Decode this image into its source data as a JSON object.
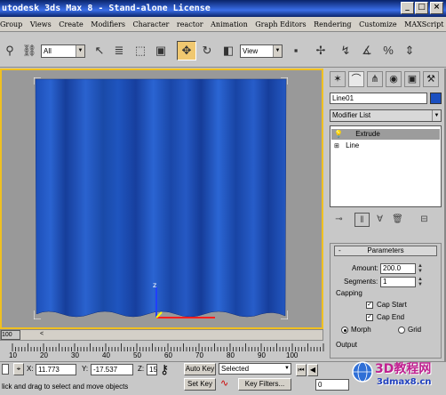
{
  "window": {
    "title": "utodesk 3ds Max 8  -  Stand-alone License"
  },
  "menu": [
    "Group",
    "Views",
    "Create",
    "Modifiers",
    "Character",
    "reactor",
    "Animation",
    "Graph Editors",
    "Rendering",
    "Customize",
    "MAXScript"
  ],
  "toolbar": {
    "selection_filter": "All",
    "ref_coord": "View"
  },
  "panel": {
    "object_name": "Line01",
    "object_color": "#1a4fc0",
    "modifier_list": "Modifier List",
    "stack": [
      {
        "label": "Extrude"
      },
      {
        "label": "Line"
      }
    ],
    "params": {
      "title": "Parameters",
      "amount_label": "Amount:",
      "amount": "200.0",
      "segments_label": "Segments:",
      "segments": "1",
      "capping_label": "Capping",
      "cap_start": "Cap Start",
      "cap_end": "Cap End",
      "morph": "Morph",
      "grid": "Grid",
      "output_label": "Output"
    }
  },
  "timeline": {
    "slider": "100",
    "ticks": [
      "10",
      "20",
      "30",
      "40",
      "50",
      "60",
      "70",
      "80",
      "90",
      "100"
    ]
  },
  "status": {
    "x_label": "X:",
    "x": "11.773",
    "y_label": "Y:",
    "y": "-17.537",
    "z_label": "Z:",
    "z": "15",
    "auto_key": "Auto Key",
    "selected": "Selected",
    "set_key": "Set Key",
    "key_filters": "Key Filters...",
    "frame": "0",
    "prompt": "lick and drag to select and move objects"
  },
  "watermark": {
    "text1": "3D教程网",
    "text2": "3dmax8.cn"
  }
}
